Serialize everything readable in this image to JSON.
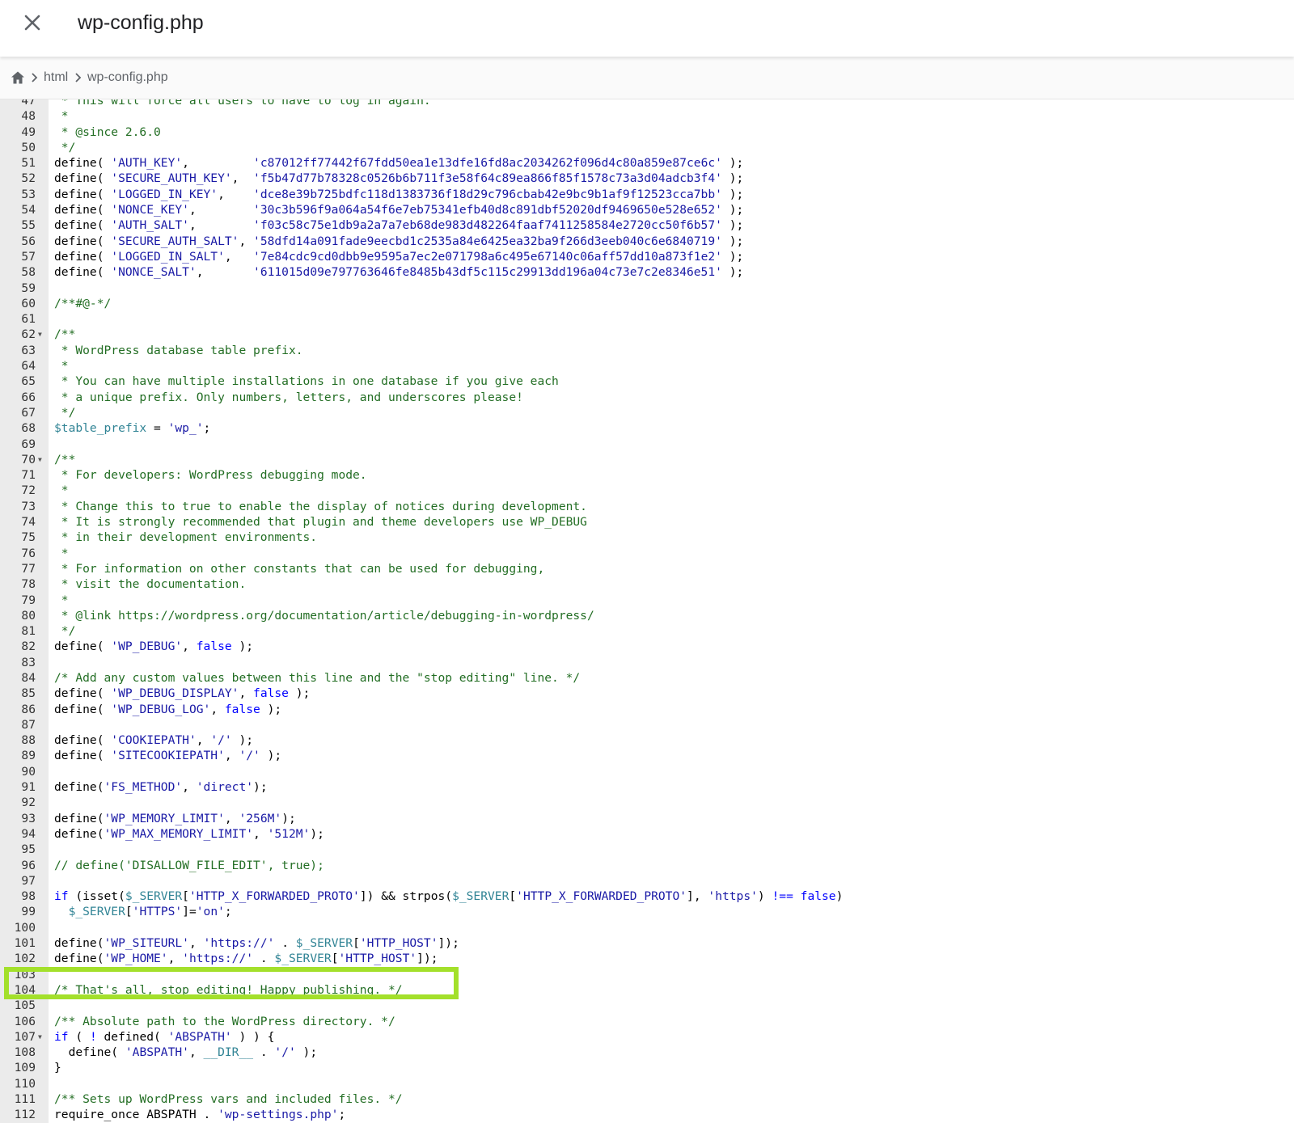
{
  "header": {
    "title": "wp-config.php",
    "close_icon": "close-icon"
  },
  "breadcrumb": {
    "home_icon": "home-icon",
    "items": [
      "html",
      "wp-config.php"
    ]
  },
  "colors": {
    "highlight_border": "#a3e02b",
    "gutter_bg": "#ebebeb",
    "comment": "#236e24",
    "string": "#1a1aa6",
    "variable": "#318495",
    "keyword": "#0000ff"
  },
  "editor": {
    "highlighted_line": 104,
    "lines": [
      {
        "n": "47",
        "t": " * This will force all users to have to log in again.",
        "k": "c"
      },
      {
        "n": "48",
        "t": " *",
        "k": "c"
      },
      {
        "n": "49",
        "t": " * @since 2.6.0",
        "k": "c"
      },
      {
        "n": "50",
        "t": " */",
        "k": "c"
      },
      {
        "n": "51",
        "t": "define( 'AUTH_KEY',         'c87012ff77442f67fdd50ea1e13dfe16fd8ac2034262f096d4c80a859e87ce6c' );",
        "k": "d"
      },
      {
        "n": "52",
        "t": "define( 'SECURE_AUTH_KEY',  'f5b47d77b78328c0526b6b711f3e58f64c89ea866f85f1578c73a3d04adcb3f4' );",
        "k": "d"
      },
      {
        "n": "53",
        "t": "define( 'LOGGED_IN_KEY',    'dce8e39b725bdfc118d1383736f18d29c796cbab42e9bc9b1af9f12523cca7bb' );",
        "k": "d"
      },
      {
        "n": "54",
        "t": "define( 'NONCE_KEY',        '30c3b596f9a064a54f6e7eb75341efb40d8c891dbf52020df9469650e528e652' );",
        "k": "d"
      },
      {
        "n": "55",
        "t": "define( 'AUTH_SALT',        'f03c58c75e1db9a2a7a7eb68de983d482264faaf7411258584e2720cc50f6b57' );",
        "k": "d"
      },
      {
        "n": "56",
        "t": "define( 'SECURE_AUTH_SALT', '58dfd14a091fade9eecbd1c2535a84e6425ea32ba9f266d3eeb040c6e6840719' );",
        "k": "d"
      },
      {
        "n": "57",
        "t": "define( 'LOGGED_IN_SALT',   '7e84cdc9cd0dbb9e9595a7ec2e071798a6c495e67140c06aff57dd10a873f1e2' );",
        "k": "d"
      },
      {
        "n": "58",
        "t": "define( 'NONCE_SALT',       '611015d09e797763646fe8485b43df5c115c29913dd196a04c73e7c2e8346e51' );",
        "k": "d"
      },
      {
        "n": "59",
        "t": "",
        "k": "d"
      },
      {
        "n": "60",
        "t": "/**#@-*/",
        "k": "c"
      },
      {
        "n": "61",
        "t": "",
        "k": "d"
      },
      {
        "n": "62",
        "t": "/**",
        "k": "c",
        "fold": true
      },
      {
        "n": "63",
        "t": " * WordPress database table prefix.",
        "k": "c"
      },
      {
        "n": "64",
        "t": " *",
        "k": "c"
      },
      {
        "n": "65",
        "t": " * You can have multiple installations in one database if you give each",
        "k": "c"
      },
      {
        "n": "66",
        "t": " * a unique prefix. Only numbers, letters, and underscores please!",
        "k": "c"
      },
      {
        "n": "67",
        "t": " */",
        "k": "c"
      },
      {
        "n": "68",
        "t": "$table_prefix = 'wp_';",
        "k": "d"
      },
      {
        "n": "69",
        "t": "",
        "k": "d"
      },
      {
        "n": "70",
        "t": "/**",
        "k": "c",
        "fold": true
      },
      {
        "n": "71",
        "t": " * For developers: WordPress debugging mode.",
        "k": "c"
      },
      {
        "n": "72",
        "t": " *",
        "k": "c"
      },
      {
        "n": "73",
        "t": " * Change this to true to enable the display of notices during development.",
        "k": "c"
      },
      {
        "n": "74",
        "t": " * It is strongly recommended that plugin and theme developers use WP_DEBUG",
        "k": "c"
      },
      {
        "n": "75",
        "t": " * in their development environments.",
        "k": "c"
      },
      {
        "n": "76",
        "t": " *",
        "k": "c"
      },
      {
        "n": "77",
        "t": " * For information on other constants that can be used for debugging,",
        "k": "c"
      },
      {
        "n": "78",
        "t": " * visit the documentation.",
        "k": "c"
      },
      {
        "n": "79",
        "t": " *",
        "k": "c"
      },
      {
        "n": "80",
        "t": " * @link https://wordpress.org/documentation/article/debugging-in-wordpress/",
        "k": "c"
      },
      {
        "n": "81",
        "t": " */",
        "k": "c"
      },
      {
        "n": "82",
        "t": "define( 'WP_DEBUG', false );",
        "k": "d"
      },
      {
        "n": "83",
        "t": "",
        "k": "d"
      },
      {
        "n": "84",
        "t": "/* Add any custom values between this line and the \"stop editing\" line. */",
        "k": "c"
      },
      {
        "n": "85",
        "t": "define( 'WP_DEBUG_DISPLAY', false );",
        "k": "d"
      },
      {
        "n": "86",
        "t": "define( 'WP_DEBUG_LOG', false );",
        "k": "d"
      },
      {
        "n": "87",
        "t": "",
        "k": "d"
      },
      {
        "n": "88",
        "t": "define( 'COOKIEPATH', '/' );",
        "k": "d"
      },
      {
        "n": "89",
        "t": "define( 'SITECOOKIEPATH', '/' );",
        "k": "d"
      },
      {
        "n": "90",
        "t": "",
        "k": "d"
      },
      {
        "n": "91",
        "t": "define('FS_METHOD', 'direct');",
        "k": "d"
      },
      {
        "n": "92",
        "t": "",
        "k": "d"
      },
      {
        "n": "93",
        "t": "define('WP_MEMORY_LIMIT', '256M');",
        "k": "d"
      },
      {
        "n": "94",
        "t": "define('WP_MAX_MEMORY_LIMIT', '512M');",
        "k": "d"
      },
      {
        "n": "95",
        "t": "",
        "k": "d"
      },
      {
        "n": "96",
        "t": "// define('DISALLOW_FILE_EDIT', true);",
        "k": "c"
      },
      {
        "n": "97",
        "t": "",
        "k": "d"
      },
      {
        "n": "98",
        "t": "if (isset($_SERVER['HTTP_X_FORWARDED_PROTO']) && strpos($_SERVER['HTTP_X_FORWARDED_PROTO'], 'https') !== false)",
        "k": "d"
      },
      {
        "n": "99",
        "t": "  $_SERVER['HTTPS']='on';",
        "k": "d"
      },
      {
        "n": "100",
        "t": "",
        "k": "d"
      },
      {
        "n": "101",
        "t": "define('WP_SITEURL', 'https://' . $_SERVER['HTTP_HOST']);",
        "k": "d"
      },
      {
        "n": "102",
        "t": "define('WP_HOME', 'https://' . $_SERVER['HTTP_HOST']);",
        "k": "d"
      },
      {
        "n": "103",
        "t": "",
        "k": "d"
      },
      {
        "n": "104",
        "t": "/* That's all, stop editing! Happy publishing. */",
        "k": "c"
      },
      {
        "n": "105",
        "t": "",
        "k": "d"
      },
      {
        "n": "106",
        "t": "/** Absolute path to the WordPress directory. */",
        "k": "c"
      },
      {
        "n": "107",
        "t": "if ( ! defined( 'ABSPATH' ) ) {",
        "k": "d",
        "fold": true
      },
      {
        "n": "108",
        "t": "  define( 'ABSPATH', __DIR__ . '/' );",
        "k": "d"
      },
      {
        "n": "109",
        "t": "}",
        "k": "d"
      },
      {
        "n": "110",
        "t": "",
        "k": "d"
      },
      {
        "n": "111",
        "t": "/** Sets up WordPress vars and included files. */",
        "k": "c"
      },
      {
        "n": "112",
        "t": "require_once ABSPATH . 'wp-settings.php';",
        "k": "d"
      }
    ]
  }
}
